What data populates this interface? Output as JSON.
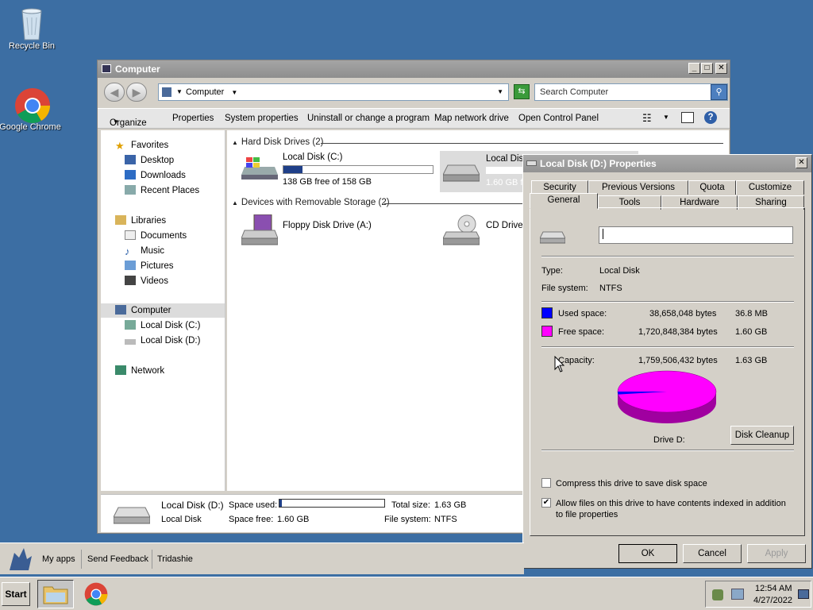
{
  "desktop": {
    "icons": [
      {
        "label": "Recycle Bin"
      },
      {
        "label": "Google Chrome"
      }
    ]
  },
  "explorer": {
    "title": "Computer",
    "address": "Computer",
    "search_placeholder": "Search Computer",
    "toolbar": {
      "organize": "Organize",
      "properties": "Properties",
      "system_properties": "System properties",
      "uninstall": "Uninstall or change a program",
      "map_drive": "Map network drive",
      "control_panel": "Open Control Panel"
    },
    "nav": {
      "favorites": "Favorites",
      "desktop": "Desktop",
      "downloads": "Downloads",
      "recent": "Recent Places",
      "libraries": "Libraries",
      "documents": "Documents",
      "music": "Music",
      "pictures": "Pictures",
      "videos": "Videos",
      "computer": "Computer",
      "disk_c": "Local Disk (C:)",
      "disk_d": "Local Disk (D:)",
      "network": "Network"
    },
    "groups": {
      "hdd": "Hard Disk Drives (2)",
      "removable": "Devices with Removable Storage (2)"
    },
    "drives": {
      "c_name": "Local Disk (C:)",
      "c_free": "138 GB free of 158 GB",
      "c_used_fraction": 0.127,
      "d_name": "Local Disk",
      "d_free": "1.60 GB fr",
      "floppy": "Floppy Disk Drive (A:)",
      "cd": "CD Drive ("
    },
    "details": {
      "name": "Local Disk (D:)",
      "type": "Local Disk",
      "space_used_label": "Space used:",
      "space_free_label": "Space free:",
      "space_free": "1.60 GB",
      "total_label": "Total size:",
      "total": "1.63 GB",
      "fs_label": "File system:",
      "fs": "NTFS",
      "used_fraction": 0.022
    }
  },
  "props": {
    "title": "Local Disk (D:) Properties",
    "tabs_row1": [
      "Security",
      "Previous Versions",
      "Quota",
      "Customize"
    ],
    "tabs_row2": [
      "General",
      "Tools",
      "Hardware",
      "Sharing"
    ],
    "label_value": "",
    "type_label": "Type:",
    "type": "Local Disk",
    "fs_label": "File system:",
    "fs": "NTFS",
    "used_label": "Used space:",
    "used_bytes": "38,658,048 bytes",
    "used_h": "36.8 MB",
    "free_label": "Free space:",
    "free_bytes": "1,720,848,384 bytes",
    "free_h": "1.60 GB",
    "cap_label": "Capacity:",
    "cap_bytes": "1,759,506,432 bytes",
    "cap_h": "1.63 GB",
    "drive_label": "Drive D:",
    "cleanup": "Disk Cleanup",
    "compress": "Compress this drive to save disk space",
    "index": "Allow files on this drive to have contents indexed in addition to file properties",
    "ok": "OK",
    "cancel": "Cancel",
    "apply": "Apply",
    "colors": {
      "used": "#0000ff",
      "free": "#ff00ff"
    }
  },
  "appbar": {
    "myapps": "My apps",
    "feedback": "Send Feedback",
    "user": "Tridashie"
  },
  "taskbar": {
    "start": "Start",
    "time": "12:54 AM",
    "date": "4/27/2022"
  }
}
